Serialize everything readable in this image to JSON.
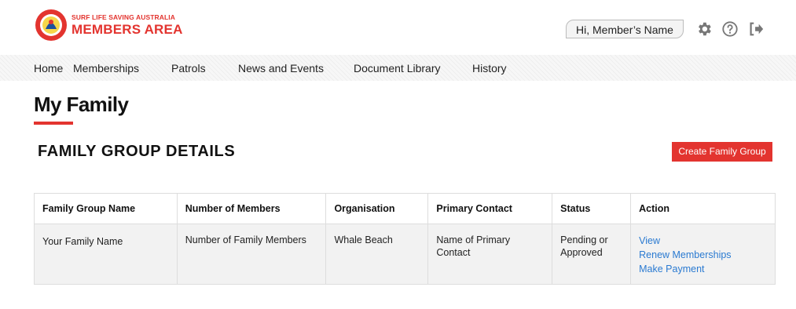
{
  "header": {
    "logo_small_text": "SURF LIFE SAVING AUSTRALIA",
    "logo_big_text": "MEMBERS AREA",
    "greeting": "Hi, Member’s Name",
    "brand_color": "#e3342f",
    "icons": [
      "gear-icon",
      "help-icon",
      "logout-icon"
    ]
  },
  "nav": {
    "items": [
      "Home",
      "Memberships",
      "Patrols",
      "News and Events",
      "Document Library",
      "History"
    ]
  },
  "page": {
    "title": "My Family",
    "section_title": "FAMILY GROUP DETAILS",
    "create_button": "Create Family Group"
  },
  "table": {
    "headers": [
      "Family Group Name",
      "Number of Members",
      "Organisation",
      "Primary Contact",
      "Status",
      "Action"
    ],
    "rows": [
      {
        "family_group_name": "Your Family Name",
        "number_of_members": "Number of Family Members",
        "organisation": "Whale Beach",
        "primary_contact": "Name of Primary Contact",
        "status": "Pending or Approved",
        "actions": [
          "View",
          "Renew Memberships",
          "Make Payment"
        ]
      }
    ]
  },
  "colors": {
    "accent": "#e3342f",
    "link": "#2a7ad1"
  }
}
